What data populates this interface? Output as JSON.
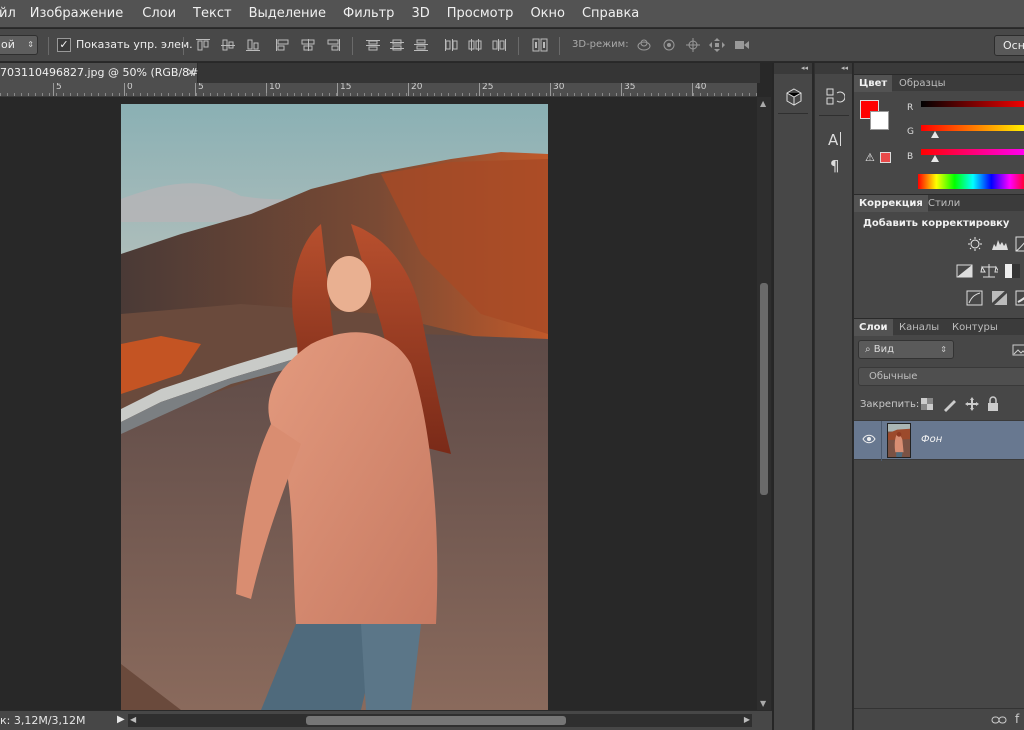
{
  "app": {
    "name": "Adobe Photoshop"
  },
  "menu": [
    "йл",
    "Изображение",
    "Слои",
    "Текст",
    "Выделение",
    "Фильтр",
    "3D",
    "Просмотр",
    "Окно",
    "Справка"
  ],
  "options": {
    "dropdown_value": "ой",
    "show_controls_label": "Показать упр. элем.",
    "show_controls_checked": true,
    "label_3d": "3D-режим:",
    "right_button": "Осно"
  },
  "document": {
    "tab_title": "703110496827.jpg @ 50% (RGB/8#)",
    "close_glyph": "×",
    "status": "к: 3,12M/3,12M"
  },
  "ruler": {
    "ticks": [
      "5",
      "0",
      "5",
      "10",
      "15",
      "20",
      "25",
      "30",
      "35",
      "40"
    ]
  },
  "panels": {
    "color": {
      "tabs": [
        "Цвет",
        "Образцы"
      ],
      "channels": [
        "R",
        "G",
        "B"
      ],
      "values": {
        "R": 255,
        "G": 0,
        "B": 0
      },
      "foreground": "#ff0000",
      "background": "#ffffff",
      "warning_swatch": "#e94a4a"
    },
    "adjustments": {
      "tabs": [
        "Коррекция",
        "Стили"
      ],
      "title": "Добавить корректировку"
    },
    "layers": {
      "tabs": [
        "Слои",
        "Каналы",
        "Контуры"
      ],
      "search_placeholder": "Вид",
      "blend_mode": "Обычные",
      "lock_label": "Закрепить:",
      "items": [
        {
          "name": "Фон",
          "visible": true,
          "selected": true
        }
      ]
    }
  }
}
